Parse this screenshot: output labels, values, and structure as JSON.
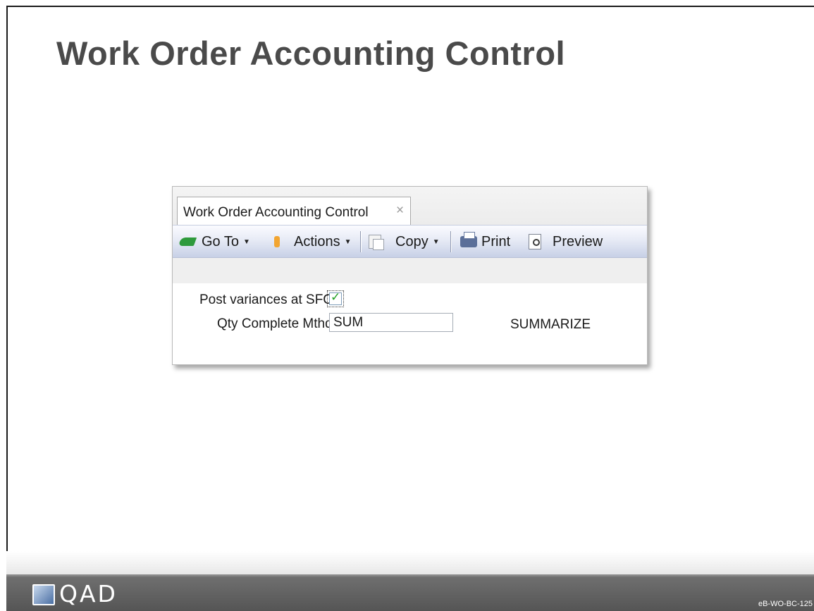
{
  "slide": {
    "title": "Work Order Accounting Control",
    "footer_logo": "QAD",
    "slide_id": "eB-WO-BC-125"
  },
  "window": {
    "tab": {
      "label": "Work Order Accounting Control",
      "close_glyph": "×"
    },
    "toolbar": {
      "goto_label": "Go To",
      "actions_label": "Actions",
      "copy_label": "Copy",
      "print_label": "Print",
      "preview_label": "Preview",
      "caret": "▼"
    },
    "form": {
      "post_variances_label": "Post variances at SFC:",
      "post_variances_checked": true,
      "qty_complete_label": "Qty Complete Mthd:",
      "qty_complete_value": "SUM",
      "qty_complete_description": "SUMMARIZE"
    }
  },
  "icons": {
    "goto": "go-to-arrow-icon",
    "actions": "actions-icon",
    "copy": "copy-icon",
    "print": "printer-icon",
    "preview": "preview-icon",
    "close": "close-icon"
  }
}
